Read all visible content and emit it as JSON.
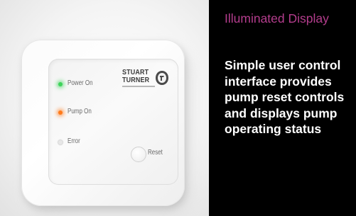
{
  "heading": "Illuminated Display",
  "description": "Simple user control interface provides pump reset controls and displays pump operating status",
  "panel": {
    "brand_line1": "STUART",
    "brand_line2": "TURNER",
    "status_items": [
      {
        "label": "Power On",
        "led_color": "#3dd35a"
      },
      {
        "label": "Pump On",
        "led_color": "#ff7a1a"
      },
      {
        "label": "Error",
        "led_color": "#e7e7e7"
      }
    ],
    "reset_label": "Reset"
  },
  "colors": {
    "heading": "#b43d8d",
    "background": "#000000",
    "body_text": "#ffffff"
  }
}
